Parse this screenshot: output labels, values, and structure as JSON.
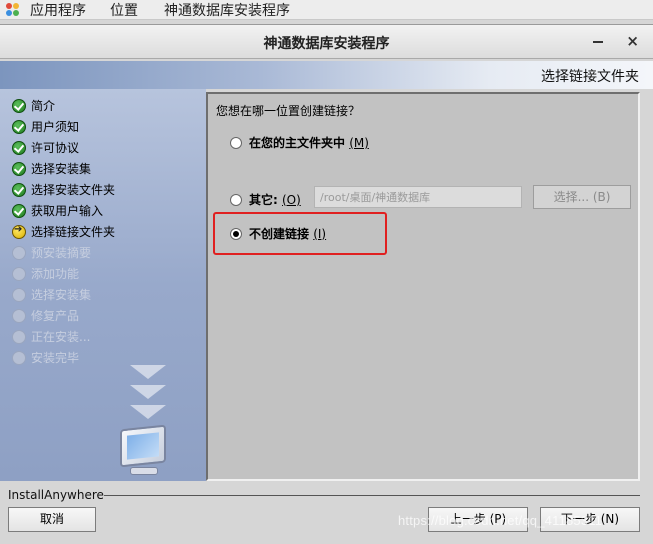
{
  "desktop_menu": {
    "applications": "应用程序",
    "places": "位置",
    "active_window": "神通数据库安装程序"
  },
  "window": {
    "title": "神通数据库安装程序",
    "close_glyph": "×"
  },
  "header": {
    "step_title": "选择链接文件夹"
  },
  "steps": [
    {
      "label": "简介",
      "state": "done"
    },
    {
      "label": "用户须知",
      "state": "done"
    },
    {
      "label": "许可协议",
      "state": "done"
    },
    {
      "label": "选择安装集",
      "state": "done"
    },
    {
      "label": "选择安装文件夹",
      "state": "done"
    },
    {
      "label": "获取用户输入",
      "state": "done"
    },
    {
      "label": "选择链接文件夹",
      "state": "current"
    },
    {
      "label": "预安装摘要",
      "state": "todo"
    },
    {
      "label": "添加功能",
      "state": "todo"
    },
    {
      "label": "选择安装集",
      "state": "todo"
    },
    {
      "label": "修复产品",
      "state": "todo"
    },
    {
      "label": "正在安装...",
      "state": "todo"
    },
    {
      "label": "安装完毕",
      "state": "todo"
    }
  ],
  "content": {
    "question": "您想在哪一位置创建链接？",
    "options": [
      {
        "label": "在您的主文件夹中",
        "mnemonic": "(M)",
        "checked": false
      },
      {
        "label": "其它:",
        "mnemonic": "(O)",
        "checked": false
      },
      {
        "label": "不创建链接",
        "mnemonic": "(I)",
        "checked": true
      }
    ],
    "path_value": "/root/桌面/神通数据库",
    "choose_button": "选择... (B)"
  },
  "footer": {
    "brand": "InstallAnywhere",
    "cancel": "取消",
    "previous": "上一步 (P)",
    "next": "下一步 (N)",
    "watermark": "https://blog.csdn.net/qq_41185311"
  },
  "colors": {
    "highlight": "#e02020",
    "done_icon": "#2e8b2e",
    "current_icon": "#f0c800"
  }
}
